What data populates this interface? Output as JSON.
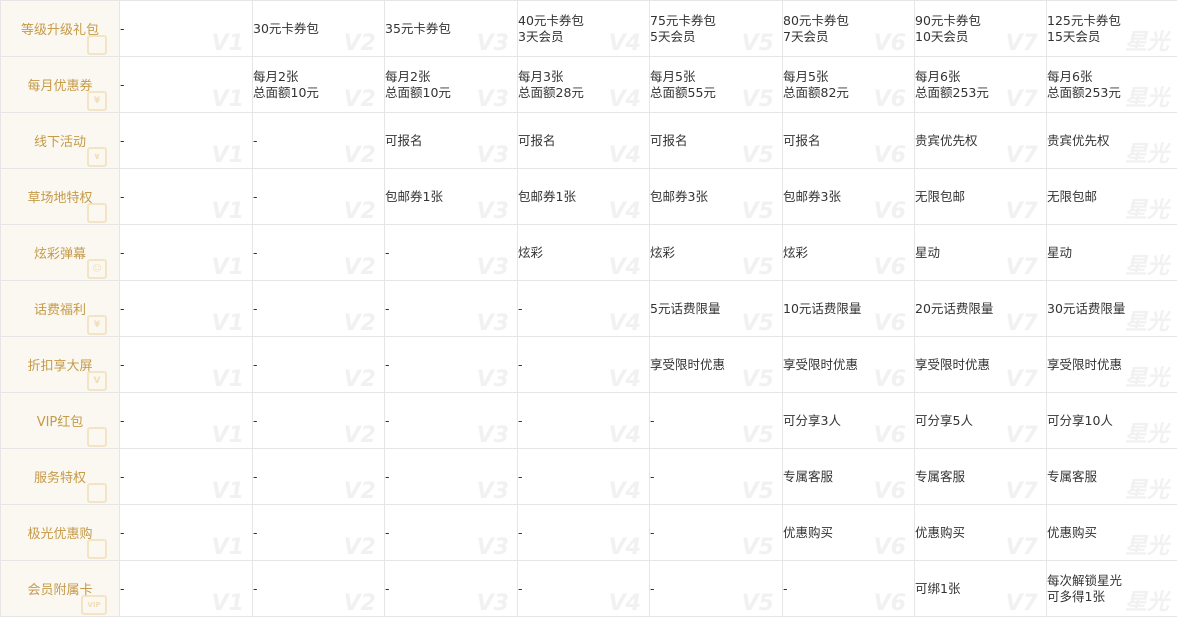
{
  "columns": [
    {
      "watermark": ""
    },
    {
      "watermark": "V1"
    },
    {
      "watermark": "V2"
    },
    {
      "watermark": "V3"
    },
    {
      "watermark": "V4"
    },
    {
      "watermark": "V5"
    },
    {
      "watermark": "V6"
    },
    {
      "watermark": "V7"
    },
    {
      "watermark": "星光"
    }
  ],
  "rows": [
    {
      "label": "等级升级礼包",
      "icon": "gift-icon",
      "cells": [
        "-",
        "30元卡券包",
        "35元卡券包",
        "40元卡券包\n3天会员",
        "75元卡券包\n5天会员",
        "80元卡券包\n7天会员",
        "90元卡券包\n10天会员",
        "125元卡券包\n15天会员"
      ]
    },
    {
      "label": "每月优惠券",
      "icon": "yen-coupon-icon",
      "cells": [
        "-",
        "每月2张\n总面额10元",
        "每月2张\n总面额10元",
        "每月3张\n总面额28元",
        "每月5张\n总面额55元",
        "每月5张\n总面额82元",
        "每月6张\n总面额253元",
        "每月6张\n总面额253元"
      ]
    },
    {
      "label": "线下活动",
      "icon": "ticket-icon",
      "cells": [
        "-",
        "-",
        "可报名",
        "可报名",
        "可报名",
        "可报名",
        "贵宾优先权",
        "贵宾优先权"
      ]
    },
    {
      "label": "草场地特权",
      "icon": "shopping-bag-icon",
      "cells": [
        "-",
        "-",
        "包邮券1张",
        "包邮券1张",
        "包邮券3张",
        "包邮券3张",
        "无限包邮",
        "无限包邮"
      ]
    },
    {
      "label": "炫彩弹幕",
      "icon": "danmaku-icon",
      "cells": [
        "-",
        "-",
        "-",
        "炫彩",
        "炫彩",
        "炫彩",
        "星动",
        "星动"
      ]
    },
    {
      "label": "话费福利",
      "icon": "phone-credit-icon",
      "cells": [
        "-",
        "-",
        "-",
        "-",
        "5元话费限量",
        "10元话费限量",
        "20元话费限量",
        "30元话费限量"
      ]
    },
    {
      "label": "折扣享大屏",
      "icon": "tv-screen-icon",
      "cells": [
        "-",
        "-",
        "-",
        "-",
        "享受限时优惠",
        "享受限时优惠",
        "享受限时优惠",
        "享受限时优惠"
      ]
    },
    {
      "label": "VIP红包",
      "icon": "red-envelope-icon",
      "cells": [
        "-",
        "-",
        "-",
        "-",
        "-",
        "可分享3人",
        "可分享5人",
        "可分享10人"
      ]
    },
    {
      "label": "服务特权",
      "icon": "service-icon",
      "cells": [
        "-",
        "-",
        "-",
        "-",
        "-",
        "专属客服",
        "专属客服",
        "专属客服"
      ]
    },
    {
      "label": "极光优惠购",
      "icon": "discount-cart-icon",
      "cells": [
        "-",
        "-",
        "-",
        "-",
        "-",
        "优惠购买",
        "优惠购买",
        "优惠购买"
      ]
    },
    {
      "label": "会员附属卡",
      "icon": "vip-card-icon",
      "cells": [
        "-",
        "-",
        "-",
        "-",
        "-",
        "-",
        "可绑1张",
        "每次解锁星光\n可多得1张"
      ]
    }
  ]
}
